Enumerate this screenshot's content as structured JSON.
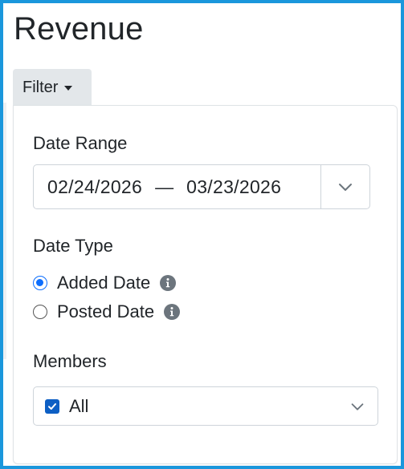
{
  "page": {
    "title": "Revenue"
  },
  "filter": {
    "button_label": "Filter",
    "date_range": {
      "label": "Date Range",
      "start": "02/24/2026",
      "separator": "—",
      "end": "03/23/2026"
    },
    "date_type": {
      "label": "Date Type",
      "options": [
        {
          "label": "Added Date",
          "checked": true
        },
        {
          "label": "Posted Date",
          "checked": false
        }
      ]
    },
    "members": {
      "label": "Members",
      "selected": "All",
      "checked": true
    }
  },
  "colors": {
    "frame_border": "#1a97dc",
    "accent": "#0d6efd",
    "checkbox": "#0d5fc4",
    "info_icon": "#6c757d",
    "filter_button_bg": "#e3e7ea"
  },
  "icons": {
    "filter_caret": "caret-down-icon",
    "date_dropdown": "chevron-down-icon",
    "members_dropdown": "chevron-down-icon",
    "info": "info-circle-icon",
    "checkbox": "checkmark-icon"
  }
}
